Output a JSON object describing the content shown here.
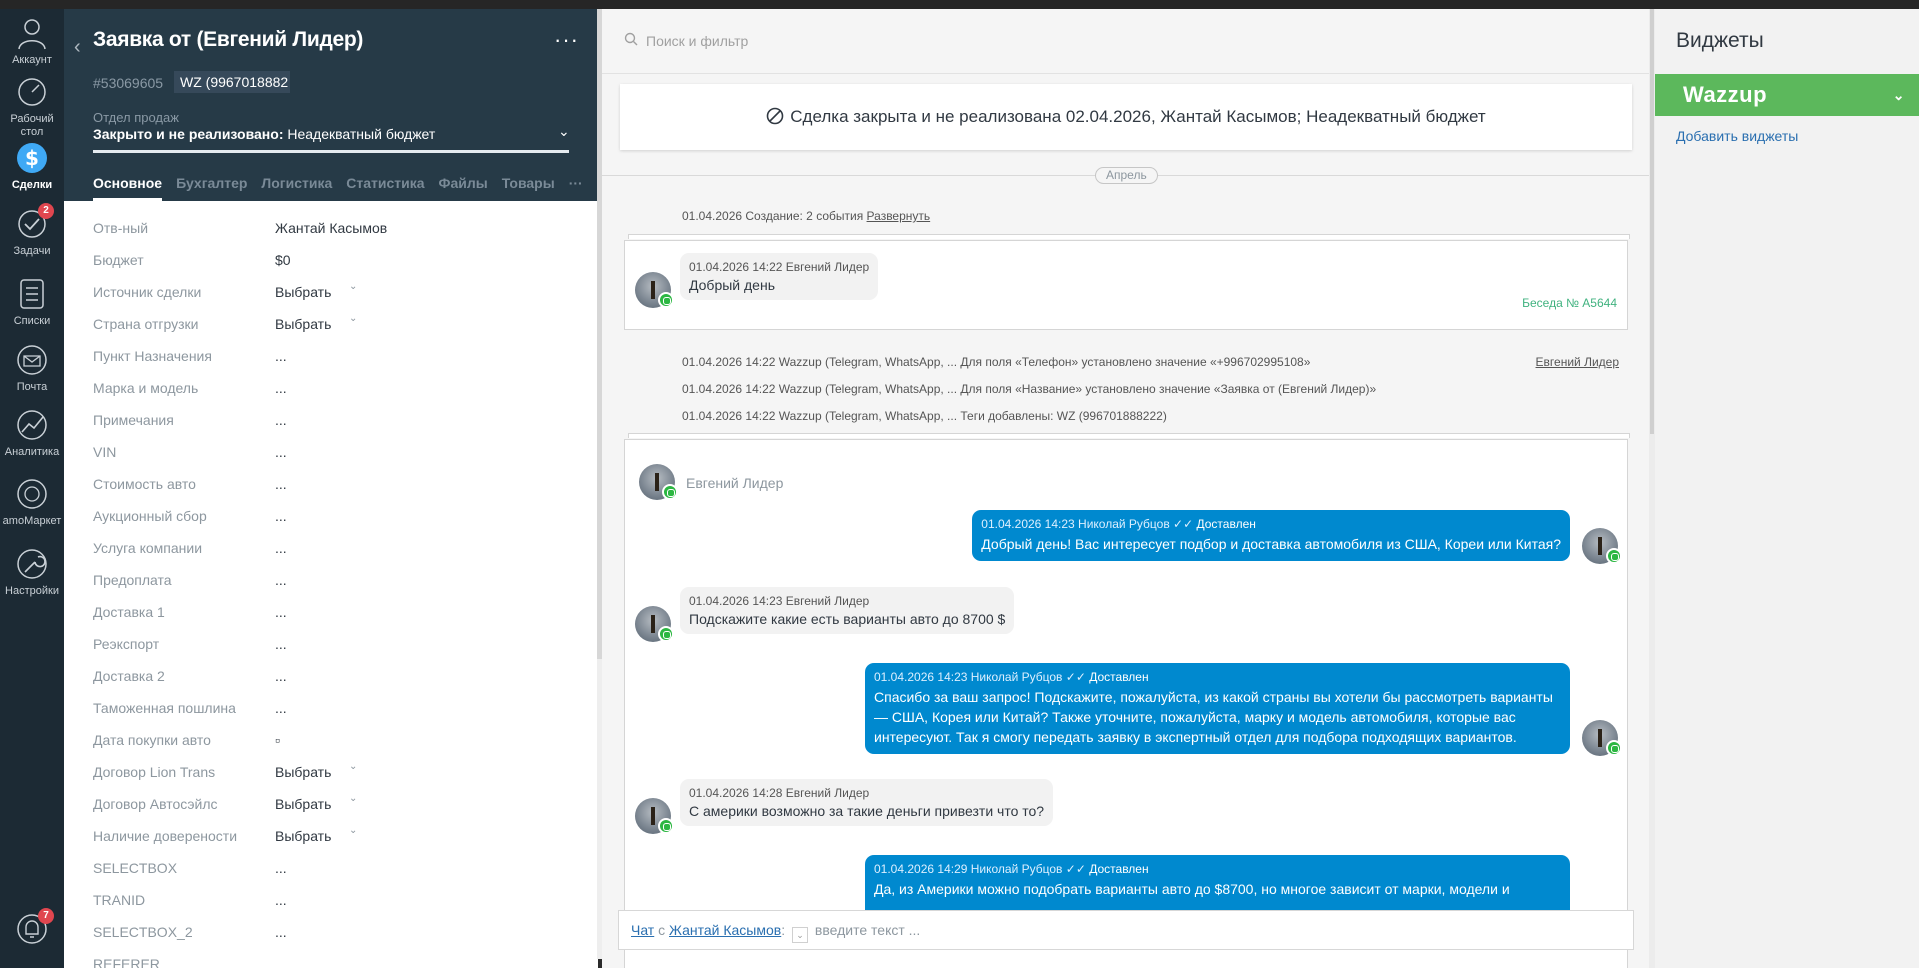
{
  "nav": {
    "account": "Аккаунт",
    "dashboard": "Рабочий стол",
    "deals": "Сделки",
    "tasks": "Задачи",
    "tasks_badge": "2",
    "lists": "Списки",
    "mail": "Почта",
    "analytics": "Аналитика",
    "market": "amoМаркет",
    "settings": "Настройки",
    "notifications_badge": "7"
  },
  "card": {
    "title": "Заявка от (Евгений Лидер)",
    "id": "#53069605",
    "tag": "WZ (9967018882",
    "pipeline": "Отдел продаж",
    "status_label": "Закрыто и не реализовано:",
    "status_reason": "Неадекватный бюджет",
    "tabs": [
      "Основное",
      "Бухгалтер",
      "Логистика",
      "Статистика",
      "Файлы",
      "Товары",
      "···"
    ],
    "fields": [
      {
        "label": "Отв-ный",
        "value": "Жантай Касымов"
      },
      {
        "label": "Бюджет",
        "value": "$0"
      },
      {
        "label": "Источник сделки",
        "value": "Выбрать"
      },
      {
        "label": "Страна отгрузки",
        "value": "Выбрать"
      },
      {
        "label": "Пункт Назначения",
        "value": "..."
      },
      {
        "label": "Марка и модель",
        "value": "..."
      },
      {
        "label": "Примечания",
        "value": "..."
      },
      {
        "label": "VIN",
        "value": "..."
      },
      {
        "label": "Стоимость авто",
        "value": "..."
      },
      {
        "label": "Аукционный сбор",
        "value": "..."
      },
      {
        "label": "Услуга компании",
        "value": "..."
      },
      {
        "label": "Предоплата",
        "value": "..."
      },
      {
        "label": "Доставка 1",
        "value": "..."
      },
      {
        "label": "Реэкспорт",
        "value": "..."
      },
      {
        "label": "Доставка 2",
        "value": "..."
      },
      {
        "label": "Таможенная пошлина",
        "value": "..."
      },
      {
        "label": "Дата покупки авто",
        "value": "▫"
      },
      {
        "label": "Договор Lion Trans",
        "value": "Выбрать"
      },
      {
        "label": "Договор Автосэйлс",
        "value": "Выбрать"
      },
      {
        "label": "Наличие довереноcти",
        "value": "Выбрать"
      },
      {
        "label": "SELECTBOX",
        "value": "..."
      },
      {
        "label": "TRANID",
        "value": "..."
      },
      {
        "label": "SELECTBOX_2",
        "value": "..."
      },
      {
        "label": "REFERER",
        "value": ""
      }
    ]
  },
  "feed": {
    "search_placeholder": "Поиск и фильтр",
    "closed_banner": "Сделка закрыта и не реализована 02.04.2026, Жантай Касымов; Неадекватный бюджет",
    "month": "Апрель",
    "created_note": "01.04.2026 Создание: 2 события",
    "expand_link": "Развернуть",
    "conv1": {
      "meta": "01.04.2026 14:22 Евгений Лидер",
      "text": "Добрый день",
      "conv_number": "Беседа № A5644"
    },
    "notes": [
      "01.04.2026 14:22 Wazzup (Telegram, WhatsApp, ... Для поля «Телефон» установлено значение «+996702995108»",
      "01.04.2026 14:22 Wazzup (Telegram, WhatsApp, ... Для поля «Название» установлено значение «Заявка от (Евгений Лидер)»",
      "01.04.2026 14:22 Wazzup (Telegram, WhatsApp, ... Теги добавлены: WZ (996701888222)"
    ],
    "notes_author": "Евгений Лидер",
    "conv2_author": "Евгений Лидер",
    "messages": [
      {
        "dir": "out",
        "meta": "01.04.2026 14:23 Николай Рубцов",
        "status": "Доставлен",
        "text": "Добрый день! Вас интересует подбор и доставка автомобиля из США, Кореи или Китая?"
      },
      {
        "dir": "in",
        "meta": "01.04.2026 14:23 Евгений Лидер",
        "text": "Подскажите какие есть варианты авто до 8700 $"
      },
      {
        "dir": "out",
        "meta": "01.04.2026 14:23 Николай Рубцов",
        "status": "Доставлен",
        "text": "Спасибо за ваш запрос! Подскажите, пожалуйста, из какой страны вы хотели бы рассмотреть варианты — США, Корея или Китай? Также уточните, пожалуйста, марку и модель автомобиля, которые вас интересуют. Так я смогу передать заявку в экспертный отдел для подбора подходящих вариантов."
      },
      {
        "dir": "in",
        "meta": "01.04.2026 14:28 Евгений Лидер",
        "text": "С америки возможно за такие деньги привезти что то?"
      },
      {
        "dir": "out",
        "meta": "01.04.2026 14:29 Николай Рубцов",
        "status": "Доставлен",
        "text": "Да, из Америки можно подобрать варианты авто до $8700, но многое зависит от марки, модели и"
      }
    ],
    "chat": {
      "chat_link": "Чат",
      "with": "с",
      "contact": "Жантай Касымов",
      "placeholder": "введите текст ..."
    }
  },
  "widgets": {
    "title": "Виджеты",
    "wazzup": "Wazzup",
    "add": "Добавить виджеты"
  },
  "colors": {
    "nav_bg": "#1c2a34",
    "card_head_bg": "#263a47",
    "outgoing_bubble": "#0089cf",
    "wazzup_green": "#5cb85c",
    "badge_red": "#e0464f",
    "link_blue": "#2a6fb0"
  }
}
